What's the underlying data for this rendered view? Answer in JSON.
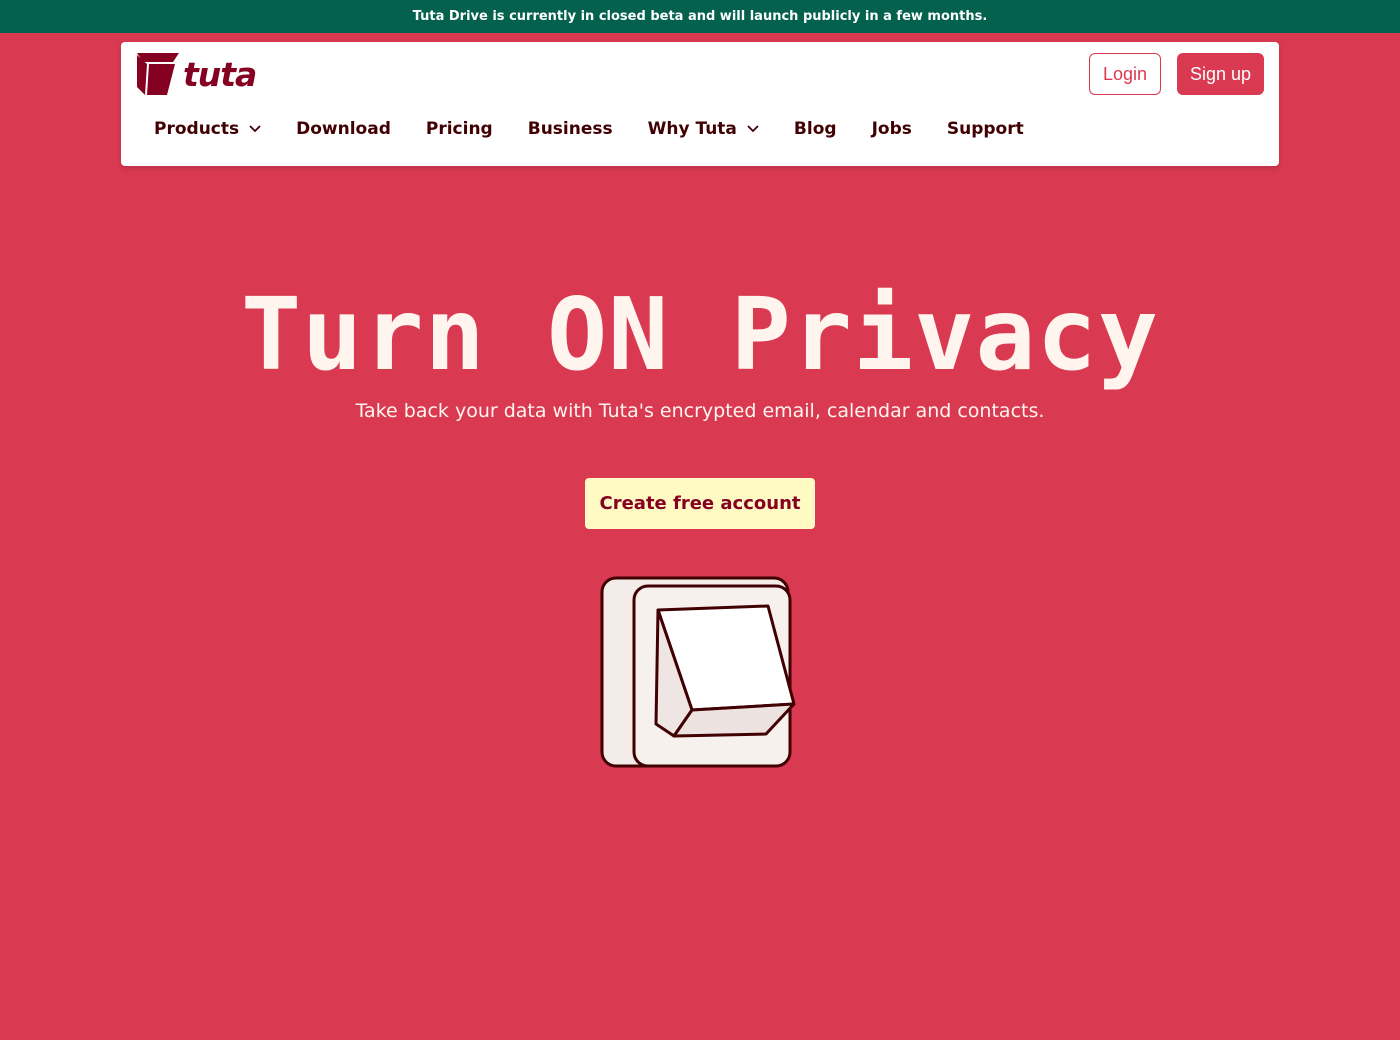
{
  "banner": {
    "text": "Tuta Drive is currently in closed beta and will launch publicly in a few months."
  },
  "header": {
    "logo_text": "tuta",
    "login_label": "Login",
    "signup_label": "Sign up",
    "nav": [
      {
        "label": "Products",
        "has_dropdown": true
      },
      {
        "label": "Download",
        "has_dropdown": false
      },
      {
        "label": "Pricing",
        "has_dropdown": false
      },
      {
        "label": "Business",
        "has_dropdown": false
      },
      {
        "label": "Why Tuta",
        "has_dropdown": true
      },
      {
        "label": "Blog",
        "has_dropdown": false
      },
      {
        "label": "Jobs",
        "has_dropdown": false
      },
      {
        "label": "Support",
        "has_dropdown": false
      }
    ]
  },
  "hero": {
    "title": "Turn ON Privacy",
    "subtitle": "Take back your data with Tuta's encrypted email, calendar and contacts.",
    "cta_label": "Create free account",
    "illustration_icon": "light-switch-icon"
  },
  "colors": {
    "background": "#d93951",
    "banner": "#03614e",
    "brand_dark": "#850122",
    "nav_text": "#410002",
    "cta_bg": "#fffac3",
    "hero_text": "#fff5ee"
  }
}
